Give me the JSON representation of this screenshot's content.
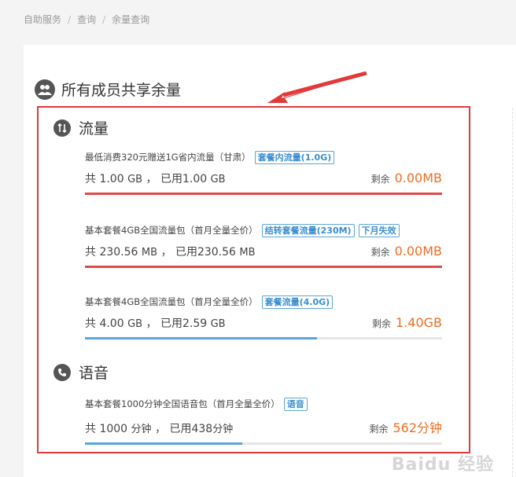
{
  "breadcrumb": {
    "items": [
      "自助服务",
      "查询",
      "余量查询"
    ],
    "separator": "/"
  },
  "section": {
    "title": "所有成员共享余量",
    "icon": "group-icon"
  },
  "flow": {
    "title": "流量",
    "icon": "updown-arrows-icon",
    "items": [
      {
        "name": "最低消费320元赠送1G省内流量（甘肃）",
        "tags": [
          "套餐内流量(1.0G)"
        ],
        "total_prefix": "共",
        "total": "1.00",
        "total_unit": "GB",
        "used_prefix": "，  已用",
        "used": "1.00",
        "used_unit": "GB",
        "remain_label": "剩余",
        "remain": "0.00MB",
        "used_ratio": 1.0,
        "bar_color": "#e0484a"
      },
      {
        "name": "基本套餐4GB全国流量包（首月全量全价）",
        "tags": [
          "结转套餐流量(230M)",
          "下月失效"
        ],
        "total_prefix": "共",
        "total": "230.56",
        "total_unit": "MB",
        "used_prefix": "，  已用",
        "used": "230.56",
        "used_unit": "MB",
        "remain_label": "剩余",
        "remain": "0.00MB",
        "used_ratio": 1.0,
        "bar_color": "#e0484a"
      },
      {
        "name": "基本套餐4GB全国流量包（首月全量全价）",
        "tags": [
          "套餐流量(4.0G)"
        ],
        "total_prefix": "共",
        "total": "4.00",
        "total_unit": "GB",
        "used_prefix": "，  已用",
        "used": "2.59",
        "used_unit": "GB",
        "remain_label": "剩余",
        "remain": "1.40GB",
        "used_ratio": 0.65,
        "bar_color": "#5aa6dc"
      }
    ]
  },
  "voice": {
    "title": "语音",
    "icon": "phone-icon",
    "items": [
      {
        "name": "基本套餐1000分钟全国语音包（首月全量全价）",
        "tags": [
          "语音"
        ],
        "total_prefix": "共",
        "total": "1000",
        "total_unit": "分钟",
        "used_prefix": "，  已用",
        "used": "438",
        "used_unit": "分钟",
        "remain_label": "剩余",
        "remain": "562分钟",
        "used_ratio": 0.44,
        "bar_color": "#5aa6dc"
      }
    ]
  },
  "colors": {
    "highlight": "#e03a3a",
    "accent": "#f26c22",
    "tag": "#3a8ed0"
  },
  "watermark": "Baidu 经验"
}
